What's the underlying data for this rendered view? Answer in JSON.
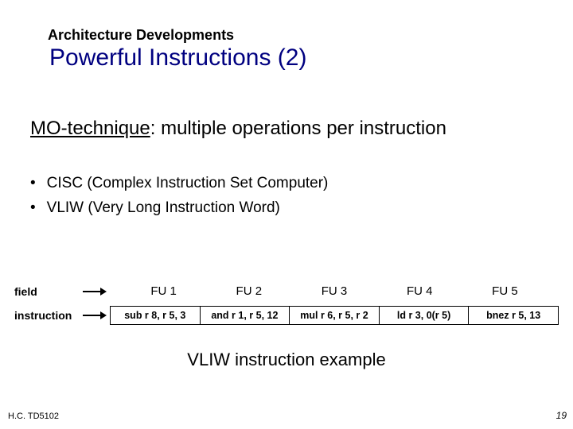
{
  "kicker": "Architecture Developments",
  "title": "Powerful Instructions (2)",
  "subtitle_term": "MO-technique",
  "subtitle_rest": ": multiple operations per instruction",
  "bullets": [
    "CISC (Complex Instruction Set Computer)",
    "VLIW (Very Long Instruction Word)"
  ],
  "diagram": {
    "field_label": "field",
    "instruction_label": "instruction",
    "fields": [
      "FU 1",
      "FU 2",
      "FU 3",
      "FU 4",
      "FU 5"
    ],
    "instructions": [
      "sub r 8, r 5, 3",
      "and r 1, r 5, 12",
      "mul r 6, r 5, r 2",
      "ld r 3, 0(r 5)",
      "bnez r 5, 13"
    ]
  },
  "caption": "VLIW instruction example",
  "footer_left": "H.C.  TD5102",
  "footer_right": "19"
}
